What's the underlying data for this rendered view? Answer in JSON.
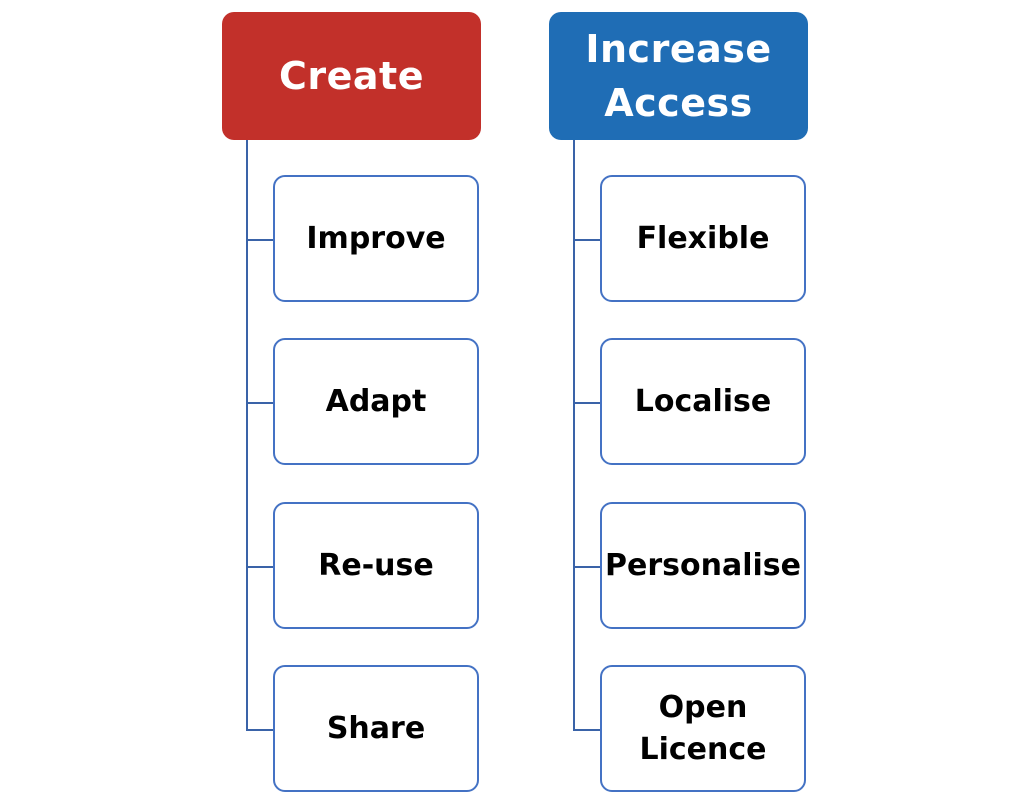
{
  "colors": {
    "create": "#c2302a",
    "increase_access": "#1f6db5",
    "connector": "#3a63a8",
    "child_border": "#4472c4"
  },
  "columns": [
    {
      "heading": "Create",
      "children": [
        "Improve",
        "Adapt",
        "Re-use",
        "Share"
      ]
    },
    {
      "heading": "Increase\nAccess",
      "children": [
        "Flexible",
        "Localise",
        "Personalise",
        "Open\nLicence"
      ]
    }
  ]
}
